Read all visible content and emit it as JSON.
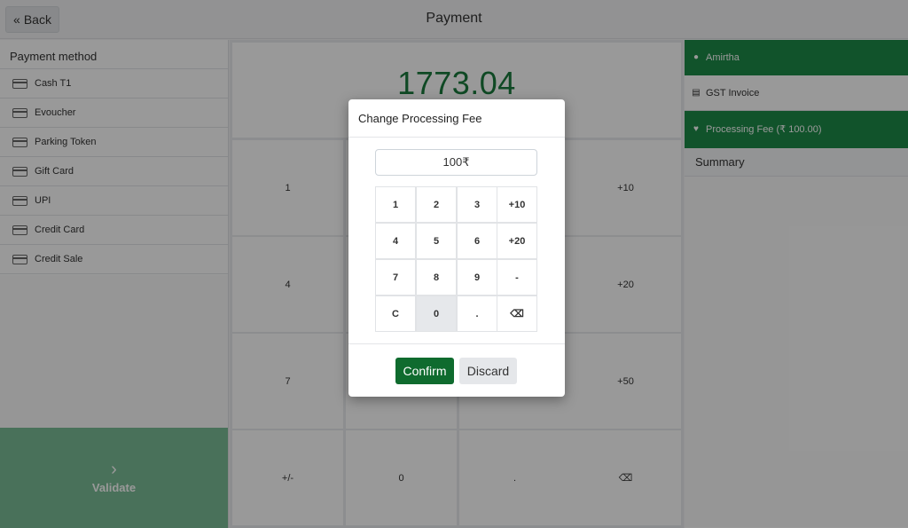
{
  "header": {
    "back_label": "Back",
    "title": "Payment"
  },
  "payment_methods": {
    "heading": "Payment method",
    "items": [
      "Cash T1",
      "Evoucher",
      "Parking Token",
      "Gift Card",
      "UPI",
      "Credit Card",
      "Credit Sale"
    ]
  },
  "validate_label": "Validate",
  "amount": "1773.04",
  "keypad": {
    "row1": [
      "1",
      "",
      "",
      "+10"
    ],
    "row2": [
      "4",
      "",
      "",
      "+20"
    ],
    "row3": [
      "7",
      "",
      "",
      "+50"
    ],
    "row4": [
      "+/-",
      "0",
      ".",
      "⌫"
    ]
  },
  "right_panel": {
    "customer": "Amirtha",
    "invoice": "GST Invoice",
    "processing_fee": "Processing Fee (₹ 100.00)",
    "summary": "Summary"
  },
  "dialog": {
    "title": "Change Processing Fee",
    "input_value": "100₹",
    "keys": [
      "1",
      "2",
      "3",
      "+10",
      "4",
      "5",
      "6",
      "+20",
      "7",
      "8",
      "9",
      "-",
      "C",
      "0",
      ".",
      "⌫"
    ],
    "confirm_label": "Confirm",
    "discard_label": "Discard"
  },
  "colors": {
    "accent": "#1d8a48",
    "confirm": "#0f6b2e",
    "amount": "#1a7a3c",
    "validate": "#7bbd96"
  }
}
